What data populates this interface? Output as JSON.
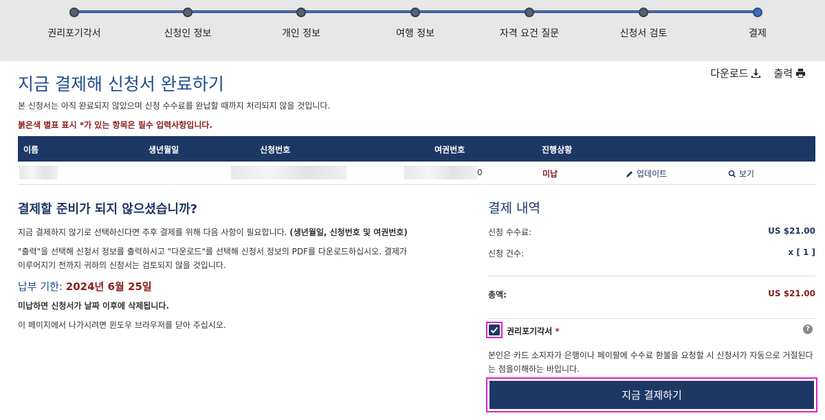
{
  "progress": {
    "steps": [
      "권리포기각서",
      "신청인 정보",
      "개인 정보",
      "여행 정보",
      "자격 요건 질문",
      "신청서 검토",
      "결제"
    ]
  },
  "header": {
    "title": "지금 결제해 신청서 완료하기",
    "download": "다운로드",
    "print": "출력",
    "intro": "본 신청서는 아직 완료되지 않았으며 신청 수수료를 완납할 때까지 처리되지 않을 것입니다.",
    "required_note": "붉은색 별표 표시 *가 있는 항목은 필수 입력사항입니다."
  },
  "table": {
    "headers": [
      "이름",
      "생년월일",
      "신청번호",
      "여권번호",
      "진행상황"
    ],
    "row": {
      "passport_tail": "0",
      "status": "미납",
      "update": "업데이트",
      "view": "보기"
    }
  },
  "left": {
    "heading": "결제할 준비가 되지 않으셨습니까?",
    "p1": "지금 결제하지 않기로 선택하신다면 추후 결제를 위해 다음 사항이 필요합니다.",
    "p1_bold": "(생년월일, 신청번호 및 여권번호)",
    "p2": "\"출력\"을 선택해 신청서 정보를 출력하시고 \"다운로드\"를 선택해 신청서 정보의 PDF를 다운로드하십시오. 결제가 이루어지기 전까지 귀하의 신청서는 검토되지 않을 것입니다.",
    "deadline_label": "납부 기한: ",
    "deadline_date": "2024년 6월 25일",
    "delete_warning": "미납하면 신청서가 날짜 이후에 삭제됩니다.",
    "close_note": "이 페이지에서 나가시려면 윈도우 브라우저를 닫아 주십시오."
  },
  "summary": {
    "heading": "결제 내역",
    "fee_label": "신청 수수료:",
    "fee_value": "US $21.00",
    "count_label": "신청 건수:",
    "count_value": "x [ 1 ]",
    "total_label": "총액:",
    "total_value": "US $21.00"
  },
  "waiver": {
    "label": "권리포기각서",
    "required_mark": "*",
    "help": "?",
    "text": "본인은 카드 소지자가 은행이나 페이팔에 수수료 환불을 요청할 시 신청서가 자동으로 거절된다는 점을이해하는 바입니다.",
    "checked": true
  },
  "pay_button": "지금 결제하기",
  "colors": {
    "navy": "#1e3866",
    "accent_red": "#8b1d1d",
    "highlight": "#e020c8"
  }
}
